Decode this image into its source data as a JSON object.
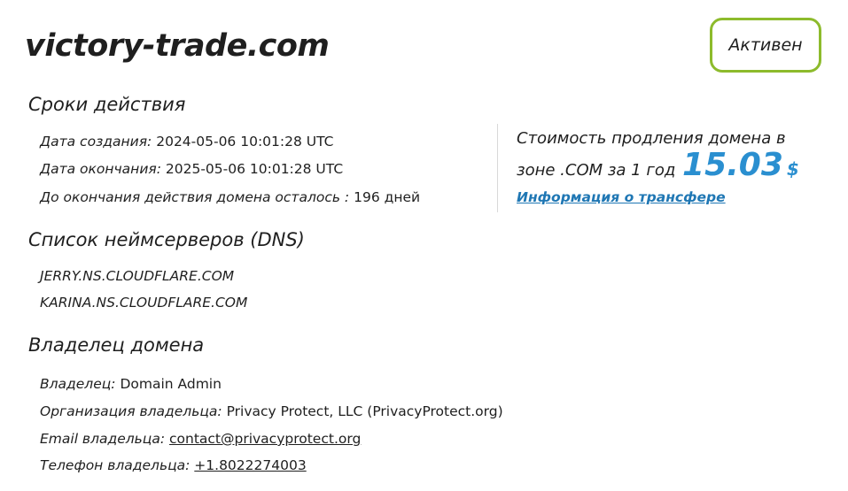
{
  "domain": "victory-trade.com",
  "status": "Активен",
  "validity": {
    "heading": "Сроки действия",
    "created_label": "Дата создания:",
    "created_value": "2024-05-06 10:01:28 UTC",
    "expires_label": "Дата окончания:",
    "expires_value": "2025-05-06 10:01:28 UTC",
    "remaining_label": "До окончания действия домена осталось :",
    "remaining_value": "196 дней"
  },
  "price": {
    "text_line1": "Стоимость продления домена в",
    "text_line2": "зоне .COM за 1 год",
    "amount": "15.03",
    "currency": "$",
    "transfer_link": "Информация о трансфере"
  },
  "nameservers": {
    "heading": "Список неймсерверов (DNS)",
    "items": [
      "JERRY.NS.CLOUDFLARE.COM",
      "KARINA.NS.CLOUDFLARE.COM"
    ]
  },
  "owner": {
    "heading": "Владелец домена",
    "owner_label": "Владелец:",
    "owner_value": "Domain Admin",
    "org_label": "Организация владельца:",
    "org_value": "Privacy Protect, LLC (PrivacyProtect.org)",
    "email_label": "Email владельца:",
    "email_value": "contact@privacyprotect.org",
    "phone_label": "Телефон владельца:",
    "phone_value": "+1.8022274003"
  }
}
